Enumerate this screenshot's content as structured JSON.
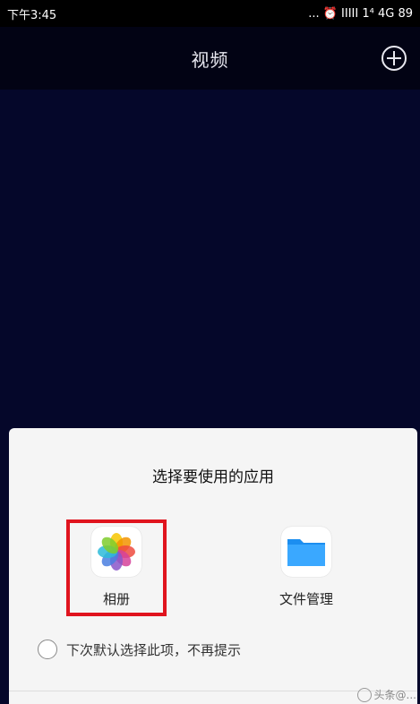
{
  "status_bar": {
    "time": "下午3:45",
    "right_text": "... ⏰ IIIII 1⁴ 4G 89"
  },
  "header": {
    "title": "视频",
    "add_icon": "plus-circle-icon"
  },
  "sheet": {
    "title": "选择要使用的应用",
    "apps": [
      {
        "label": "相册",
        "icon": "photos-icon",
        "selected": true
      },
      {
        "label": "文件管理",
        "icon": "folder-icon",
        "selected": false
      }
    ],
    "remember_text": "下次默认选择此项，不再提示",
    "highlight_color": "#e0141e"
  },
  "watermark": "头条@..."
}
